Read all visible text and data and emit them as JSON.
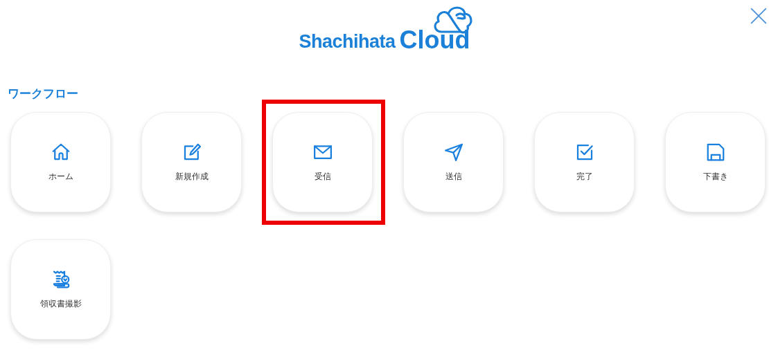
{
  "logo": {
    "brand": "Shachihata",
    "product": "Cloud"
  },
  "section": {
    "title": "ワークフロー"
  },
  "tiles": [
    {
      "label": "ホーム",
      "highlighted": false
    },
    {
      "label": "新規作成",
      "highlighted": false
    },
    {
      "label": "受信",
      "highlighted": true
    },
    {
      "label": "送信",
      "highlighted": false
    },
    {
      "label": "完了",
      "highlighted": false
    },
    {
      "label": "下書き",
      "highlighted": false
    },
    {
      "label": "領収書撮影",
      "highlighted": false
    }
  ]
}
